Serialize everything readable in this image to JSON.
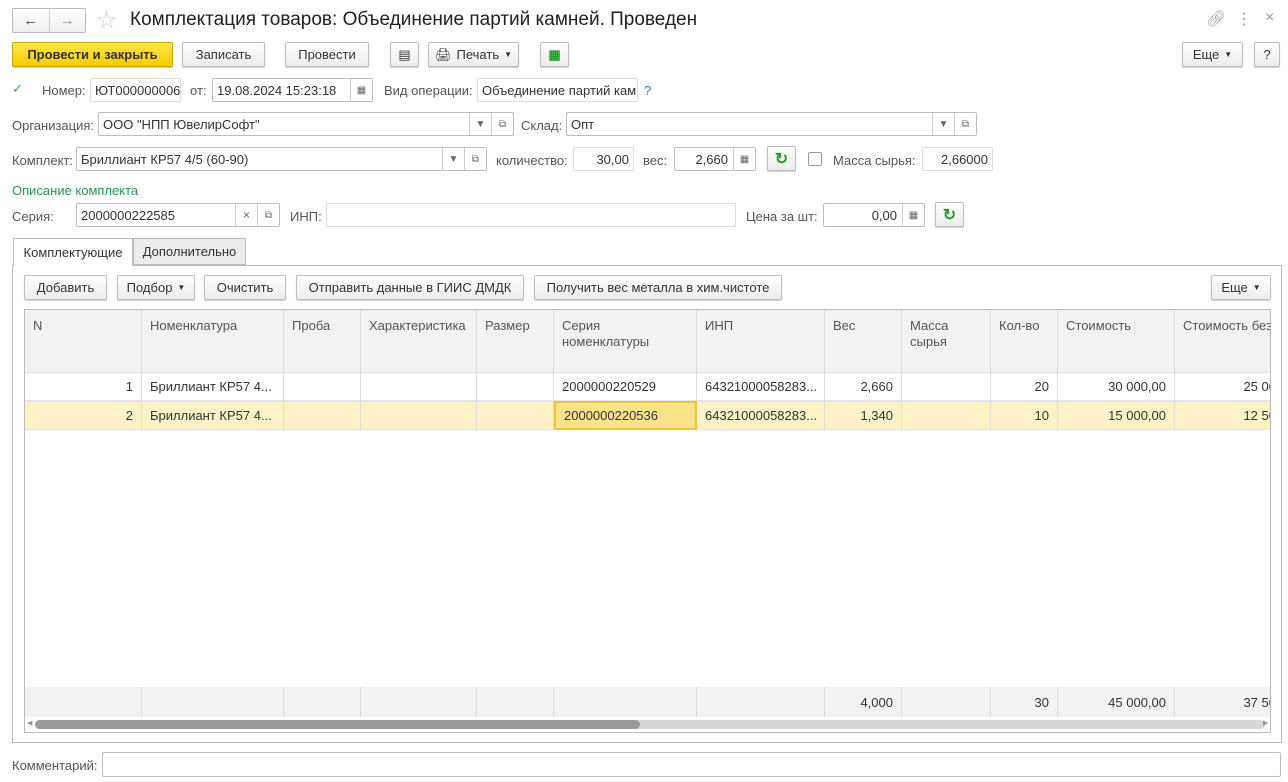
{
  "title": "Комплектация товаров: Объединение партий камней. Проведен",
  "toolbar": {
    "post_close": "Провести и закрыть",
    "save": "Записать",
    "post": "Провести",
    "print": "Печать",
    "more": "Еще",
    "help": "?"
  },
  "header": {
    "number_label": "Номер:",
    "number": "ЮТ000000006",
    "date_label": "от:",
    "date": "19.08.2024 15:23:18",
    "op_label": "Вид операции:",
    "op": "Объединение партий кам",
    "op_help": "?",
    "org_label": "Организация:",
    "org": "ООО \"НПП ЮвелирСофт\"",
    "wh_label": "Склад:",
    "wh": "Опт",
    "kit_label": "Комплект:",
    "kit": "Бриллиант КР57 4/5 (60-90)",
    "qty_label": "количество:",
    "qty": "30,00",
    "weight_label": "вес:",
    "weight": "2,660",
    "raw_label": "Масса сырья:",
    "raw": "2,66000",
    "raw_checked": false,
    "desc_title": "Описание комплекта",
    "series_label": "Серия:",
    "series": "2000000222585",
    "inp_label": "ИНП:",
    "inp": "",
    "price_label": "Цена за шт:",
    "price": "0,00"
  },
  "tabs": [
    {
      "label": "Комплектующие",
      "active": true
    },
    {
      "label": "Дополнительно",
      "active": false
    }
  ],
  "table_toolbar": {
    "add": "Добавить",
    "pick": "Подбор",
    "clear": "Очистить",
    "send": "Отправить данные в ГИИС ДМДК",
    "get": "Получить вес металла в хим.чистоте",
    "more": "Еще"
  },
  "table": {
    "columns": [
      "N",
      "Номенклатура",
      "Проба",
      "Характеристика",
      "Размер",
      "Серия номенклатуры",
      "ИНП",
      "Вес",
      "Масса сырья",
      "Кол-во",
      "Стоимость",
      "Стоимость без"
    ],
    "rows": [
      [
        "1",
        "Бриллиант КР57 4...",
        "",
        "",
        "",
        "2000000220529",
        "64321000058283...",
        "2,660",
        "",
        "20",
        "30 000,00",
        "25 00"
      ],
      [
        "2",
        "Бриллиант КР57 4...",
        "",
        "",
        "",
        "2000000220536",
        "64321000058283...",
        "1,340",
        "",
        "10",
        "15 000,00",
        "12 50"
      ]
    ],
    "totals": [
      "",
      "",
      "",
      "",
      "",
      "",
      "",
      "4,000",
      "",
      "30",
      "45 000,00",
      "37 50"
    ],
    "selected_row": 1
  },
  "comment": {
    "label": "Комментарий:",
    "value": ""
  }
}
